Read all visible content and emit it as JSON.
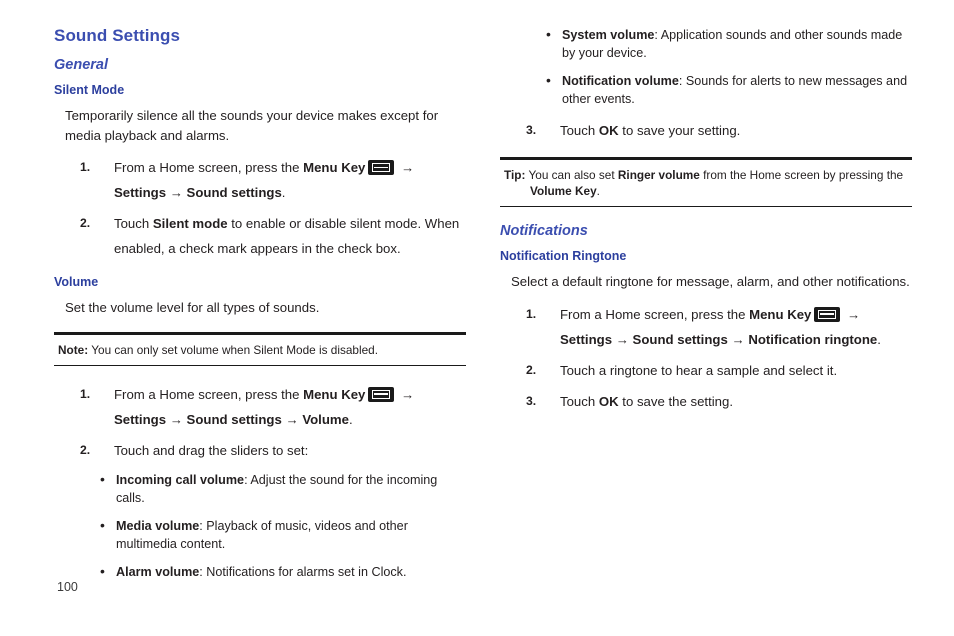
{
  "page": {
    "number": "100",
    "title": "Sound Settings"
  },
  "icons": {
    "menu_key": "menu-key-icon",
    "arrow": "→",
    "bullet": "•"
  },
  "left_column": {
    "section_heading": "General",
    "silent_mode": {
      "heading": "Silent Mode",
      "intro": "Temporarily silence all the sounds your device makes except for media playback and alarms.",
      "steps": [
        {
          "num": "1.",
          "parts": [
            {
              "t": "From a Home screen, press the ",
              "b": false
            },
            {
              "t": "Menu Key",
              "b": true
            },
            {
              "t": "icon",
              "b": false
            },
            {
              "t": " → ",
              "b": true
            },
            {
              "t": "Settings",
              "b": true
            },
            {
              "t": " → ",
              "b": true
            },
            {
              "t": "Sound settings",
              "b": true
            },
            {
              "t": ".",
              "b": false
            }
          ]
        },
        {
          "num": "2.",
          "parts": [
            {
              "t": "Touch ",
              "b": false
            },
            {
              "t": "Silent mode",
              "b": true
            },
            {
              "t": " to enable or disable silent mode. When enabled, a check mark appears in the check box.",
              "b": false
            }
          ]
        }
      ]
    },
    "volume": {
      "heading": "Volume",
      "intro": "Set the volume level for all types of sounds.",
      "note": {
        "label": "Note:",
        "text": " You can only set volume when Silent Mode is disabled."
      },
      "steps": [
        {
          "num": "1.",
          "parts": [
            {
              "t": "From a Home screen, press the ",
              "b": false
            },
            {
              "t": "Menu Key",
              "b": true
            },
            {
              "t": "icon",
              "b": false
            },
            {
              "t": " → ",
              "b": true
            },
            {
              "t": "Settings",
              "b": true
            },
            {
              "t": " → ",
              "b": true
            },
            {
              "t": "Sound settings",
              "b": true
            },
            {
              "t": " → ",
              "b": true
            },
            {
              "t": "Volume",
              "b": true
            },
            {
              "t": ".",
              "b": false
            }
          ]
        },
        {
          "num": "2.",
          "parts": [
            {
              "t": "Touch and drag the sliders to set:",
              "b": false
            }
          ]
        }
      ],
      "bullets": [
        {
          "term": "Incoming call volume",
          "desc": ": Adjust the sound for the incoming calls."
        },
        {
          "term": "Media volume",
          "desc": ": Playback of music, videos and other multimedia content."
        },
        {
          "term": "Alarm volume",
          "desc": ": Notifications for alarms set in Clock."
        }
      ]
    }
  },
  "right_column": {
    "volume_bullets_continued": [
      {
        "term": "System volume",
        "desc": ": Application sounds and other sounds made by your device."
      },
      {
        "term": "Notification volume",
        "desc": ": Sounds for alerts to new messages and other events."
      }
    ],
    "volume_step3": {
      "num": "3.",
      "parts": [
        {
          "t": "Touch ",
          "b": false
        },
        {
          "t": "OK",
          "b": true
        },
        {
          "t": " to save your setting.",
          "b": false
        }
      ]
    },
    "tip": {
      "label": "Tip:",
      "line1_a": " You can also set ",
      "line1_b": "Ringer volume",
      "line1_c": " from the Home screen by pressing the ",
      "line2_a": "Volume Key",
      "line2_b": "."
    },
    "notifications": {
      "section_heading": "Notifications",
      "heading": "Notification Ringtone",
      "intro": "Select a default ringtone for message, alarm, and other notifications.",
      "steps": [
        {
          "num": "1.",
          "parts": [
            {
              "t": "From a Home screen, press the ",
              "b": false
            },
            {
              "t": "Menu Key",
              "b": true
            },
            {
              "t": "icon",
              "b": false
            },
            {
              "t": " → ",
              "b": true
            },
            {
              "t": "Settings",
              "b": true
            },
            {
              "t": " → ",
              "b": true
            },
            {
              "t": "Sound settings",
              "b": true
            },
            {
              "t": " → ",
              "b": true
            },
            {
              "t": "Notification ringtone",
              "b": true
            },
            {
              "t": ".",
              "b": false
            }
          ]
        },
        {
          "num": "2.",
          "parts": [
            {
              "t": "Touch a ringtone to hear a sample and select it.",
              "b": false
            }
          ]
        },
        {
          "num": "3.",
          "parts": [
            {
              "t": "Touch ",
              "b": false
            },
            {
              "t": "OK",
              "b": true
            },
            {
              "t": " to save the setting.",
              "b": false
            }
          ]
        }
      ]
    }
  },
  "colors": {
    "heading_blue": "#3b4eb0",
    "subheading_blue": "#2c3f9e",
    "body_text": "#231f20",
    "rule": "#1a1a1a"
  }
}
